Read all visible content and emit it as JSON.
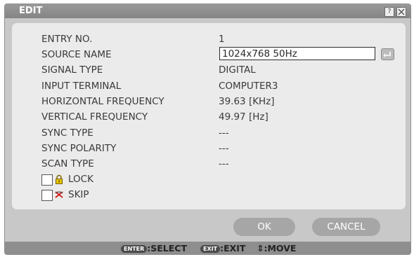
{
  "dialog": {
    "title": "EDIT",
    "help_label": "?"
  },
  "fields": [
    {
      "label": "ENTRY NO.",
      "value": "1"
    },
    {
      "label": "SOURCE NAME",
      "value": ""
    },
    {
      "label": "SIGNAL TYPE",
      "value": "DIGITAL"
    },
    {
      "label": "INPUT TERMINAL",
      "value": "COMPUTER3"
    },
    {
      "label": "HORIZONTAL FREQUENCY",
      "value": "39.63 [KHz]"
    },
    {
      "label": "VERTICAL FREQUENCY",
      "value": "49.97 [Hz]"
    },
    {
      "label": "SYNC TYPE",
      "value": "---"
    },
    {
      "label": "SYNC POLARITY",
      "value": "---"
    },
    {
      "label": "SCAN TYPE",
      "value": "---"
    }
  ],
  "source_name_input": "1024x768 50Hz",
  "checks": [
    {
      "label": "LOCK",
      "icon": "lock-icon",
      "checked": false
    },
    {
      "label": "SKIP",
      "icon": "skip-icon",
      "checked": false
    }
  ],
  "buttons": {
    "ok": "OK",
    "cancel": "CANCEL"
  },
  "footer": {
    "enter_key": "ENTER",
    "select": ":SELECT",
    "exit_key": "EXIT",
    "exit": ":EXIT",
    "move_icon": "up-down-arrow-icon",
    "move": ":MOVE"
  },
  "colors": {
    "title_bar": "#8e8e8e",
    "panel": "#ebebeb",
    "button": "#a6a6a6",
    "lock_icon": "#e6c200",
    "skip_icon": "#d42020"
  }
}
